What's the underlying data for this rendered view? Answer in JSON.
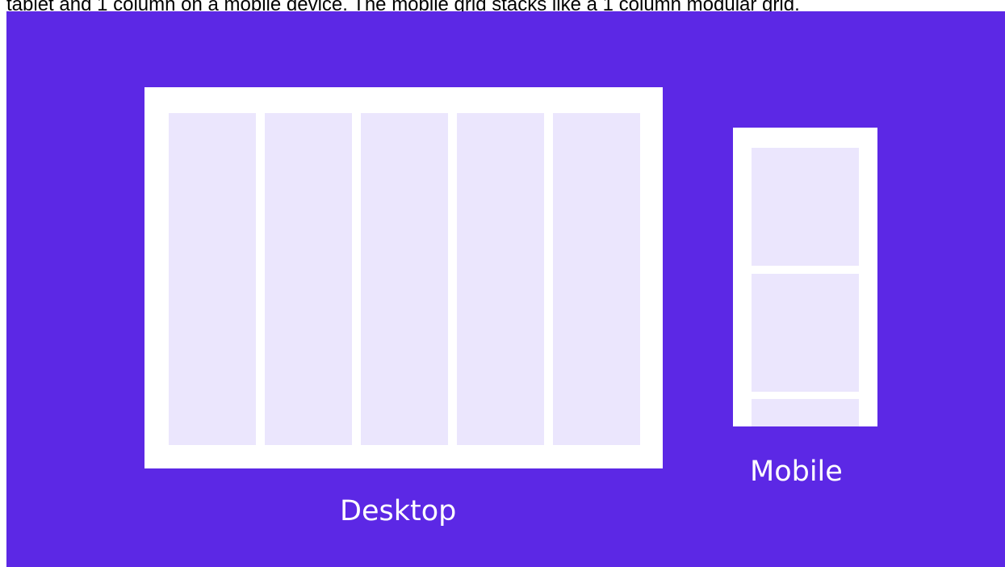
{
  "caption": "tablet and 1 column on a mobile device. The mobile grid stacks like a 1 column modular grid.",
  "diagram": {
    "background_color": "#5c28e5",
    "frame_color": "#ffffff",
    "cell_color": "#ebe6fd",
    "desktop": {
      "label": "Desktop",
      "columns": 5
    },
    "mobile": {
      "label": "Mobile",
      "columns": 1,
      "visible_rows": 3
    }
  }
}
